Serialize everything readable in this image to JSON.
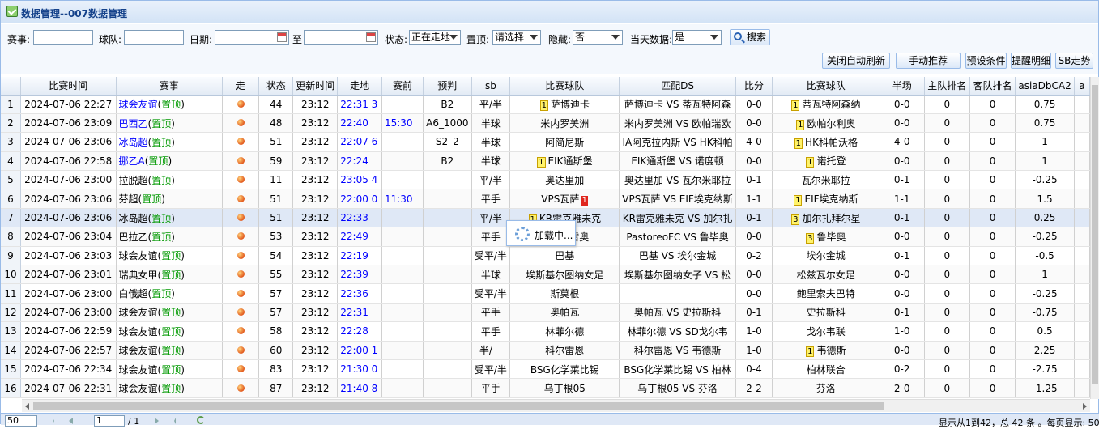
{
  "window": {
    "title": "数据管理--007数据管理"
  },
  "filters": {
    "match_label": "赛事:",
    "team_label": "球队:",
    "date_label": "日期:",
    "to_label": "至",
    "status_label": "状态:",
    "status_value": "正在走地",
    "pin_label": "置顶:",
    "pin_value": "请选择",
    "hide_label": "隐藏:",
    "hide_value": "否",
    "today_label": "当天数据:",
    "today_value": "是",
    "search_button": "搜索"
  },
  "actions": {
    "close_refresh": "关闭自动刷新",
    "manual_recommend": "手动推荐",
    "preset": "预设条件",
    "reminder": "提醒明细",
    "sb_trend": "SB走势"
  },
  "columns": [
    "比赛时间",
    "赛事",
    "走",
    "状态",
    "更新时间",
    "走地",
    "赛前",
    "预判",
    "sb",
    "比赛球队",
    "匹配DS",
    "比分",
    "比赛球队",
    "半场",
    "主队排名",
    "客队排名",
    "asiaDbCA2",
    "a"
  ],
  "rows": [
    {
      "n": "1",
      "time": "2024-07-06 22:27",
      "league": "球会友谊",
      "pin": "置顶",
      "league_blue": true,
      "status": "44",
      "upd": "23:12",
      "live": "22:31 3",
      "pre": "",
      "pred": "B2",
      "sb": "平/半",
      "team": "萨博迪卡",
      "team_rank": "1",
      "team_red": "",
      "ds": "萨博迪卡 VS 蒂瓦特阿森",
      "score": "0-0",
      "team2": "蒂瓦特阿森纳",
      "team2_rank": "1",
      "half": "0-0",
      "hr": "0",
      "ar": "0",
      "asia": "0.75"
    },
    {
      "n": "2",
      "time": "2024-07-06 23:09",
      "league": "巴西乙",
      "pin": "置顶",
      "league_blue": true,
      "status": "48",
      "upd": "23:12",
      "live": "22:40",
      "pre": "15:30",
      "pred": "A6_1000",
      "sb": "半球",
      "team": "米内罗美洲",
      "team_rank": "",
      "team_red": "",
      "ds": "米内罗美洲 VS 欧帕瑞欧",
      "score": "0-0",
      "team2": "欧帕尔利奥",
      "team2_rank": "1",
      "half": "0-0",
      "hr": "0",
      "ar": "0",
      "asia": "0.75"
    },
    {
      "n": "3",
      "time": "2024-07-06 23:06",
      "league": "冰岛超",
      "pin": "置顶",
      "league_blue": true,
      "status": "51",
      "upd": "23:12",
      "live": "22:07 6",
      "pre": "",
      "pred": "S2_2",
      "sb": "半球",
      "team": "阿简尼斯",
      "team_rank": "",
      "team_red": "",
      "ds": "IA阿克拉内斯 VS HK科帕",
      "score": "4-0",
      "team2": "HK科帕沃格",
      "team2_rank": "1",
      "half": "4-0",
      "hr": "0",
      "ar": "0",
      "asia": "1"
    },
    {
      "n": "4",
      "time": "2024-07-06 22:58",
      "league": "挪乙A",
      "pin": "置顶",
      "league_blue": true,
      "status": "59",
      "upd": "23:12",
      "live": "22:24",
      "pre": "",
      "pred": "B2",
      "sb": "半球",
      "team": "EIK通斯堡",
      "team_rank": "1",
      "team_red": "",
      "ds": "EIK通斯堡 VS 诺度顿",
      "score": "0-0",
      "team2": "诺托登",
      "team2_rank": "1",
      "half": "0-0",
      "hr": "0",
      "ar": "0",
      "asia": "1"
    },
    {
      "n": "5",
      "time": "2024-07-06 23:00",
      "league": "拉脱超",
      "pin": "置顶",
      "league_blue": false,
      "status": "11",
      "upd": "23:12",
      "live": "23:05 4",
      "pre": "",
      "pred": "",
      "sb": "平/半",
      "team": "奥达里加",
      "team_rank": "",
      "team_red": "",
      "ds": "奥达里加 VS 瓦尔米耶拉",
      "score": "0-1",
      "team2": "瓦尔米耶拉",
      "team2_rank": "",
      "half": "0-1",
      "hr": "0",
      "ar": "0",
      "asia": "-0.25"
    },
    {
      "n": "6",
      "time": "2024-07-06 23:06",
      "league": "芬超",
      "pin": "置顶",
      "league_blue": false,
      "status": "51",
      "upd": "23:12",
      "live": "22:00 0",
      "pre": "11:30",
      "pred": "",
      "sb": "平手",
      "team": "VPS瓦萨",
      "team_rank": "",
      "team_red": "1",
      "ds": "VPS瓦萨 VS EIF埃克纳斯",
      "score": "1-1",
      "team2": "EIF埃克纳斯",
      "team2_rank": "1",
      "half": "1-1",
      "hr": "0",
      "ar": "0",
      "asia": "1.5"
    },
    {
      "n": "7",
      "time": "2024-07-06 23:06",
      "league": "冰岛超",
      "pin": "置顶",
      "league_blue": false,
      "status": "51",
      "upd": "23:12",
      "live": "22:33",
      "pre": "",
      "pred": "",
      "sb": "平/半",
      "team": "KR雷克雅未克",
      "team_rank": "1",
      "team_red": "",
      "ds": "KR雷克雅未克 VS 加尔扎",
      "score": "0-1",
      "team2": "加尔扎拜尔星",
      "team2_rank": "3",
      "half": "0-1",
      "hr": "0",
      "ar": "0",
      "asia": "0.25"
    },
    {
      "n": "8",
      "time": "2024-07-06 23:04",
      "league": "巴拉乙",
      "pin": "置顶",
      "league_blue": false,
      "status": "53",
      "upd": "23:12",
      "live": "22:49",
      "pre": "",
      "pred": "",
      "sb": "平手",
      "team": "帕斯托雷奥",
      "team_rank": "",
      "team_red": "",
      "ds": "PastoreoFC VS 鲁毕奥",
      "score": "0-0",
      "team2": "鲁毕奥",
      "team2_rank": "3",
      "half": "0-0",
      "hr": "0",
      "ar": "0",
      "asia": "-0.25"
    },
    {
      "n": "9",
      "time": "2024-07-06 23:03",
      "league": "球会友谊",
      "pin": "置顶",
      "league_blue": false,
      "status": "54",
      "upd": "23:12",
      "live": "22:19",
      "pre": "",
      "pred": "",
      "sb": "受平/半",
      "team": "巴基",
      "team_rank": "",
      "team_red": "",
      "ds": "巴基 VS 埃尔金城",
      "score": "0-2",
      "team2": "埃尔金城",
      "team2_rank": "",
      "half": "0-1",
      "hr": "0",
      "ar": "0",
      "asia": "-0.5"
    },
    {
      "n": "10",
      "time": "2024-07-06 23:01",
      "league": "瑞典女甲",
      "pin": "置顶",
      "league_blue": false,
      "status": "55",
      "upd": "23:12",
      "live": "22:39",
      "pre": "",
      "pred": "",
      "sb": "半球",
      "team": "埃斯基尔图纳女足",
      "team_rank": "",
      "team_red": "",
      "ds": "埃斯基尔图纳女子 VS 松",
      "score": "0-0",
      "team2": "松兹瓦尔女足",
      "team2_rank": "",
      "half": "0-0",
      "hr": "0",
      "ar": "0",
      "asia": "1"
    },
    {
      "n": "11",
      "time": "2024-07-06 23:00",
      "league": "白俄超",
      "pin": "置顶",
      "league_blue": false,
      "status": "57",
      "upd": "23:12",
      "live": "22:36",
      "pre": "",
      "pred": "",
      "sb": "受平/半",
      "team": "斯莫根",
      "team_rank": "",
      "team_red": "",
      "ds": "",
      "score": "0-0",
      "team2": "鲍里索夫巴特",
      "team2_rank": "",
      "half": "0-0",
      "hr": "0",
      "ar": "0",
      "asia": "-0.25"
    },
    {
      "n": "12",
      "time": "2024-07-06 23:00",
      "league": "球会友谊",
      "pin": "置顶",
      "league_blue": false,
      "status": "57",
      "upd": "23:12",
      "live": "22:31",
      "pre": "",
      "pred": "",
      "sb": "平手",
      "team": "奥帕瓦",
      "team_rank": "",
      "team_red": "",
      "ds": "奥帕瓦 VS 史拉斯科",
      "score": "0-1",
      "team2": "史拉斯科",
      "team2_rank": "",
      "half": "0-1",
      "hr": "0",
      "ar": "0",
      "asia": "-0.75"
    },
    {
      "n": "13",
      "time": "2024-07-06 22:59",
      "league": "球会友谊",
      "pin": "置顶",
      "league_blue": false,
      "status": "58",
      "upd": "23:12",
      "live": "22:28",
      "pre": "",
      "pred": "",
      "sb": "平手",
      "team": "林菲尔德",
      "team_rank": "",
      "team_red": "",
      "ds": "林菲尔德 VS SD戈尔韦",
      "score": "1-0",
      "team2": "戈尔韦联",
      "team2_rank": "",
      "half": "1-0",
      "hr": "0",
      "ar": "0",
      "asia": "0.5"
    },
    {
      "n": "14",
      "time": "2024-07-06 22:57",
      "league": "球会友谊",
      "pin": "置顶",
      "league_blue": false,
      "status": "60",
      "upd": "23:12",
      "live": "22:00 1",
      "pre": "",
      "pred": "",
      "sb": "半/一",
      "team": "科尔雷恩",
      "team_rank": "",
      "team_red": "",
      "ds": "科尔雷恩 VS 韦德斯",
      "score": "1-0",
      "team2": "韦德斯",
      "team2_rank": "1",
      "half": "0-0",
      "hr": "0",
      "ar": "0",
      "asia": "2.25"
    },
    {
      "n": "15",
      "time": "2024-07-06 22:34",
      "league": "球会友谊",
      "pin": "置顶",
      "league_blue": false,
      "status": "83",
      "upd": "23:12",
      "live": "21:30 0",
      "pre": "",
      "pred": "",
      "sb": "受平/半",
      "team": "BSG化学莱比锡",
      "team_rank": "",
      "team_red": "",
      "ds": "BSG化学莱比锡 VS 柏林",
      "score": "0-4",
      "team2": "柏林联合",
      "team2_rank": "",
      "half": "0-2",
      "hr": "0",
      "ar": "0",
      "asia": "-2.75"
    },
    {
      "n": "16",
      "time": "2024-07-06 22:31",
      "league": "球会友谊",
      "pin": "置顶",
      "league_blue": false,
      "status": "87",
      "upd": "23:12",
      "live": "21:40 8",
      "pre": "",
      "pred": "",
      "sb": "平手",
      "team": "乌丁根05",
      "team_rank": "",
      "team_red": "",
      "ds": "乌丁根05 VS 芬洛",
      "score": "2-2",
      "team2": "芬洛",
      "team2_rank": "",
      "half": "2-0",
      "hr": "0",
      "ar": "0",
      "asia": "-1.25"
    }
  ],
  "loading": {
    "text": "加载中..."
  },
  "pager": {
    "page_size": "50",
    "page_value": "1",
    "page_total": "/ 1",
    "summary": "显示从1到42，总 42 条 。每页显示: 50"
  }
}
